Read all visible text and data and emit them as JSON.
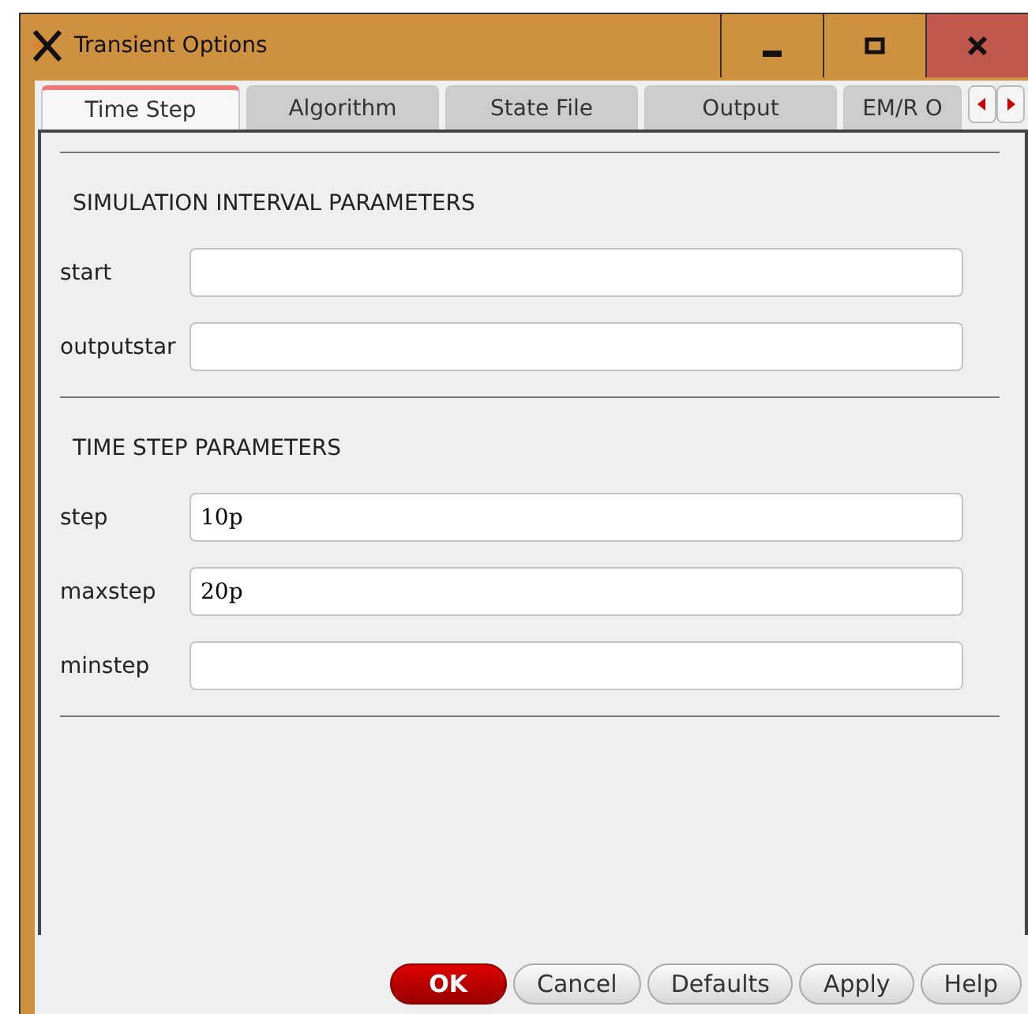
{
  "window": {
    "title": "Transient Options"
  },
  "tabs": [
    {
      "label": "Time Step",
      "selected": true
    },
    {
      "label": "Algorithm",
      "selected": false
    },
    {
      "label": "State File",
      "selected": false
    },
    {
      "label": "Output",
      "selected": false
    },
    {
      "label": "EM/R O",
      "selected": false
    }
  ],
  "sections": [
    {
      "title": "SIMULATION INTERVAL PARAMETERS",
      "fields": [
        {
          "label": "start"
        },
        {
          "label": "outputstar"
        }
      ]
    },
    {
      "title": "TIME STEP PARAMETERS",
      "fields": [
        {
          "label": "step",
          "value": "10p"
        },
        {
          "label": "maxstep",
          "value": "20p"
        },
        {
          "label": "minstep"
        }
      ]
    }
  ],
  "buttons": [
    {
      "label": "OK",
      "kind": "primary"
    },
    {
      "label": "Cancel",
      "kind": "normal"
    },
    {
      "label": "Defaults",
      "kind": "normal"
    },
    {
      "label": "Apply",
      "kind": "normal"
    },
    {
      "label": "Help",
      "kind": "normal"
    }
  ]
}
